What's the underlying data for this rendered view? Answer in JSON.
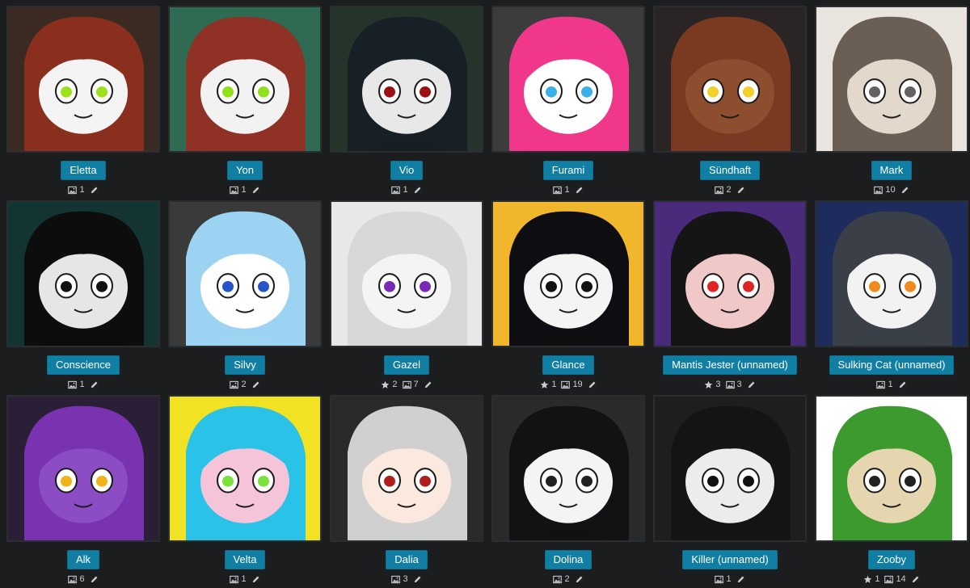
{
  "characters": [
    {
      "name": "Eletta",
      "favorites": null,
      "images": "1",
      "bg": "#3a2a22",
      "hair": "#8a2e1e",
      "skin": "#f4f4f4",
      "eye": "#9be21d"
    },
    {
      "name": "Yon",
      "favorites": null,
      "images": "1",
      "bg": "#2f6b52",
      "hair": "#8f3124",
      "skin": "#f2f2f2",
      "eye": "#8fe21b"
    },
    {
      "name": "Vio",
      "favorites": null,
      "images": "1",
      "bg": "#24342a",
      "hair": "#162026",
      "skin": "#e8e8e8",
      "eye": "#9b1010"
    },
    {
      "name": "Furami",
      "favorites": null,
      "images": "1",
      "bg": "#3c3c3c",
      "hair": "#f0378a",
      "skin": "#ffffff",
      "eye": "#3ab0e8"
    },
    {
      "name": "Sündhaft",
      "favorites": null,
      "images": "2",
      "bg": "#2a2424",
      "hair": "#7a3a22",
      "skin": "#8c4e2e",
      "eye": "#f2d12b"
    },
    {
      "name": "Mark",
      "favorites": null,
      "images": "10",
      "bg": "#e9e5de",
      "hair": "#6b5e55",
      "skin": "#e3d8cc",
      "eye": "#666060"
    },
    {
      "name": "Conscience",
      "favorites": null,
      "images": "1",
      "bg": "#143434",
      "hair": "#0d0d0d",
      "skin": "#e6e6e6",
      "eye": "#111111"
    },
    {
      "name": "Silvy",
      "favorites": null,
      "images": "2",
      "bg": "#3a3a3a",
      "hair": "#9dd3f2",
      "skin": "#ffffff",
      "eye": "#2553c8"
    },
    {
      "name": "Gazel",
      "favorites": "2",
      "images": "7",
      "bg": "#e8e8e8",
      "hair": "#d8d8d8",
      "skin": "#f4f4f4",
      "eye": "#7a2bb5"
    },
    {
      "name": "Glance",
      "favorites": "1",
      "images": "19",
      "bg": "#f0b72c",
      "hair": "#0e0e12",
      "skin": "#f4f4f4",
      "eye": "#111111"
    },
    {
      "name": "Mantis Jester (unnamed)",
      "favorites": "3",
      "images": "3",
      "bg": "#4a2a7a",
      "hair": "#151515",
      "skin": "#f0c8c8",
      "eye": "#e02424"
    },
    {
      "name": "Sulking Cat (unnamed)",
      "favorites": null,
      "images": "1",
      "bg": "#1d2c5c",
      "hair": "#3a3f48",
      "skin": "#f2f2f2",
      "eye": "#f08a1a"
    },
    {
      "name": "Alk",
      "favorites": null,
      "images": "6",
      "bg": "#2a1f36",
      "hair": "#7a33b0",
      "skin": "#8c4cc4",
      "eye": "#f2b21a"
    },
    {
      "name": "Velta",
      "favorites": null,
      "images": "1",
      "bg": "#f2e224",
      "hair": "#2bc2e8",
      "skin": "#f6c4d8",
      "eye": "#7be23c"
    },
    {
      "name": "Dalia",
      "favorites": null,
      "images": "3",
      "bg": "#2a2a2a",
      "hair": "#d0d0d0",
      "skin": "#fbe8de",
      "eye": "#b21e1e"
    },
    {
      "name": "Dolina",
      "favorites": null,
      "images": "2",
      "bg": "#2a2a2a",
      "hair": "#121214",
      "skin": "#f4f4f4",
      "eye": "#222222"
    },
    {
      "name": "Killer (unnamed)",
      "favorites": null,
      "images": "1",
      "bg": "#1e1e1e",
      "hair": "#141414",
      "skin": "#ececec",
      "eye": "#111111"
    },
    {
      "name": "Zooby",
      "favorites": "1",
      "images": "14",
      "bg": "#ffffff",
      "hair": "#3c9a2e",
      "skin": "#e6d6b0",
      "eye": "#222222"
    }
  ]
}
